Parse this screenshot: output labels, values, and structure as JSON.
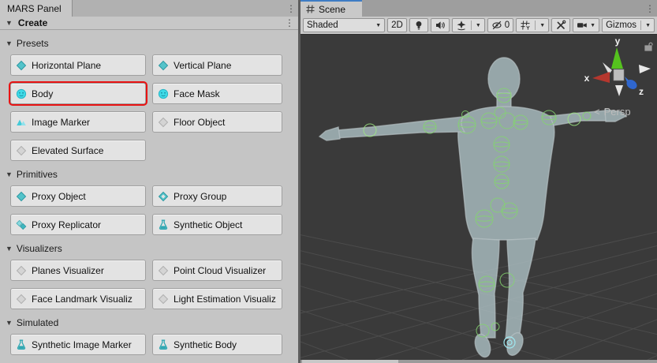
{
  "mars_panel": {
    "tab_title": "MARS Panel",
    "header_title": "Create",
    "sections": [
      {
        "label": "Presets",
        "buttons": [
          {
            "label": "Horizontal Plane",
            "icon": "diamond-teal-icon"
          },
          {
            "label": "Vertical Plane",
            "icon": "diamond-teal-icon"
          },
          {
            "label": "Body",
            "icon": "face-icon",
            "highlighted": true
          },
          {
            "label": "Face Mask",
            "icon": "face-icon"
          },
          {
            "label": "Image Marker",
            "icon": "image-marker-icon"
          },
          {
            "label": "Floor Object",
            "icon": "diamond-gray-icon"
          },
          {
            "label": "Elevated Surface",
            "icon": "diamond-gray-icon"
          }
        ]
      },
      {
        "label": "Primitives",
        "buttons": [
          {
            "label": "Proxy Object",
            "icon": "diamond-teal-icon"
          },
          {
            "label": "Proxy Group",
            "icon": "proxy-group-icon"
          },
          {
            "label": "Proxy Replicator",
            "icon": "proxy-replicator-icon"
          },
          {
            "label": "Synthetic Object",
            "icon": "flask-icon"
          }
        ]
      },
      {
        "label": "Visualizers",
        "buttons": [
          {
            "label": "Planes Visualizer",
            "icon": "diamond-gray-icon"
          },
          {
            "label": "Point Cloud Visualizer",
            "icon": "diamond-gray-icon"
          },
          {
            "label": "Face Landmark Visualiz",
            "icon": "diamond-gray-icon"
          },
          {
            "label": "Light Estimation Visualiz",
            "icon": "diamond-gray-icon"
          }
        ]
      },
      {
        "label": "Simulated",
        "buttons": [
          {
            "label": "Synthetic Image Marker",
            "icon": "flask-icon"
          },
          {
            "label": "Synthetic Body",
            "icon": "flask-icon"
          }
        ]
      }
    ]
  },
  "scene": {
    "tab_title": "Scene",
    "toolbar": {
      "shading_mode": "Shaded",
      "mode_2d_label": "2D",
      "hidden_count": "0",
      "gizmos_label": "Gizmos",
      "icons": [
        "lightbulb-icon",
        "speaker-icon",
        "effects-star-icon",
        "eye-slash-icon",
        "grid-snap-icon",
        "tools-icon",
        "camera-icon"
      ]
    },
    "viewport": {
      "persp_arrow": "<",
      "persp_label": "Persp",
      "axis_labels": {
        "x": "x",
        "y": "y",
        "z": "z"
      }
    }
  },
  "colors": {
    "highlight_red": "#e81313",
    "tab_accent_blue": "#3e7cc4",
    "preset_teal": "#53c3ca",
    "preset_cyan": "#3fdbe8",
    "joint_green": "#84d470",
    "axis_x_red": "#b5372e",
    "axis_y_green": "#55c21e",
    "axis_z_blue": "#3672d8"
  }
}
